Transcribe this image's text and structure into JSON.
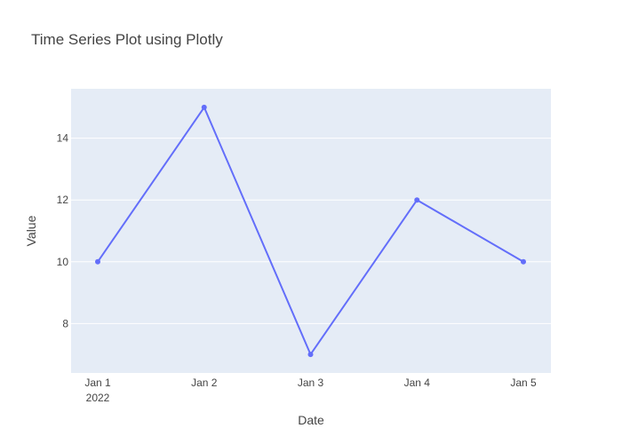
{
  "chart_data": {
    "type": "line",
    "title": "Time Series Plot using Plotly",
    "xlabel": "Date",
    "ylabel": "Value",
    "x": [
      "2022-01-01",
      "2022-01-02",
      "2022-01-03",
      "2022-01-04",
      "2022-01-05"
    ],
    "x_tick_labels": [
      "Jan 1",
      "Jan 2",
      "Jan 3",
      "Jan 4",
      "Jan 5"
    ],
    "x_tick_sublabel": "2022",
    "y_ticks": [
      8,
      10,
      12,
      14
    ],
    "ylim": [
      6.4,
      15.6
    ],
    "grid": true,
    "legend": "none",
    "series": [
      {
        "values": [
          10,
          15,
          7,
          12,
          10
        ],
        "color": "#636efa",
        "mode": "lines+markers"
      }
    ],
    "colors": {
      "plot_background": "#e5ecf6",
      "paper_background": "#ffffff",
      "gridline": "#ffffff",
      "text": "#444444"
    }
  }
}
